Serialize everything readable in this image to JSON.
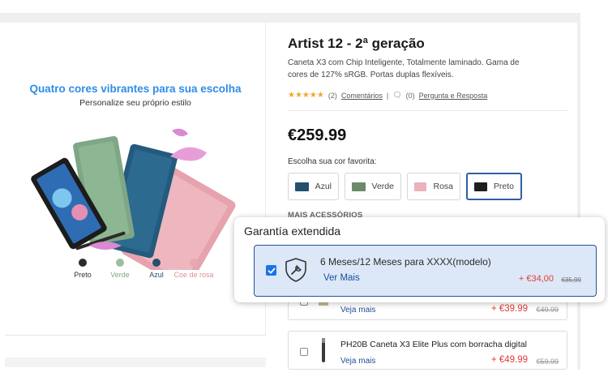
{
  "left": {
    "promo_title": "Quatro cores vibrantes para sua escolha",
    "promo_subtitle": "Personalize seu próprio estilo",
    "swatches": [
      {
        "label": "Preto",
        "color": "#2b2b2b",
        "text_color": "#333333"
      },
      {
        "label": "Verde",
        "color": "#9dbf9f",
        "text_color": "#7fa583"
      },
      {
        "label": "Azul",
        "color": "#25506e",
        "text_color": "#25506e"
      },
      {
        "label": "Coe de rosa",
        "color": "#e8a7b1",
        "text_color": "#e08c9a"
      }
    ]
  },
  "product": {
    "title": "Artist 12 - 2ª geração",
    "description": "Caneta X3 com Chip Inteligente, Totalmente laminado. Gama de cores de 127% sRGB. Portas duplas flexíveis.",
    "stars": "★★★★★",
    "review_count": "(2)",
    "reviews_link": "Comentários",
    "divider": "|",
    "qa_count": "(0)",
    "qa_link": "Pergunta e Resposta",
    "price": "€259.99",
    "color_label": "Escolha sua cor favorita:",
    "colors": [
      {
        "label": "Azul",
        "thumb": "#24506e"
      },
      {
        "label": "Verde",
        "thumb": "#6d8a6a"
      },
      {
        "label": "Rosa",
        "thumb": "#e9b3bb"
      },
      {
        "label": "Preto",
        "thumb": "#1e1e1e"
      }
    ],
    "accessories_label": "MAIS ACESSÓRIOS"
  },
  "accessories": [
    {
      "name": "",
      "more": "Veja mais",
      "price": "+ €39.99",
      "old_price": "€49.99"
    },
    {
      "name": "PH20B Caneta X3 Elite Plus com borracha digital",
      "more": "Veja mais",
      "price": "+ €49.99",
      "old_price": "€59.99"
    }
  ],
  "warranty": {
    "title": "Garantía extendida",
    "option_title": "6 Meses/12 Meses para XXXX(modelo)",
    "more": "Ver Mais",
    "price": "+ €34,00",
    "old_price": "€35,99",
    "checked": true
  },
  "colors": {
    "accent_blue": "#2e8de8",
    "brand_navy": "#2a5297",
    "sale_red": "#e33a3a",
    "star_orange": "#f2a52b"
  }
}
